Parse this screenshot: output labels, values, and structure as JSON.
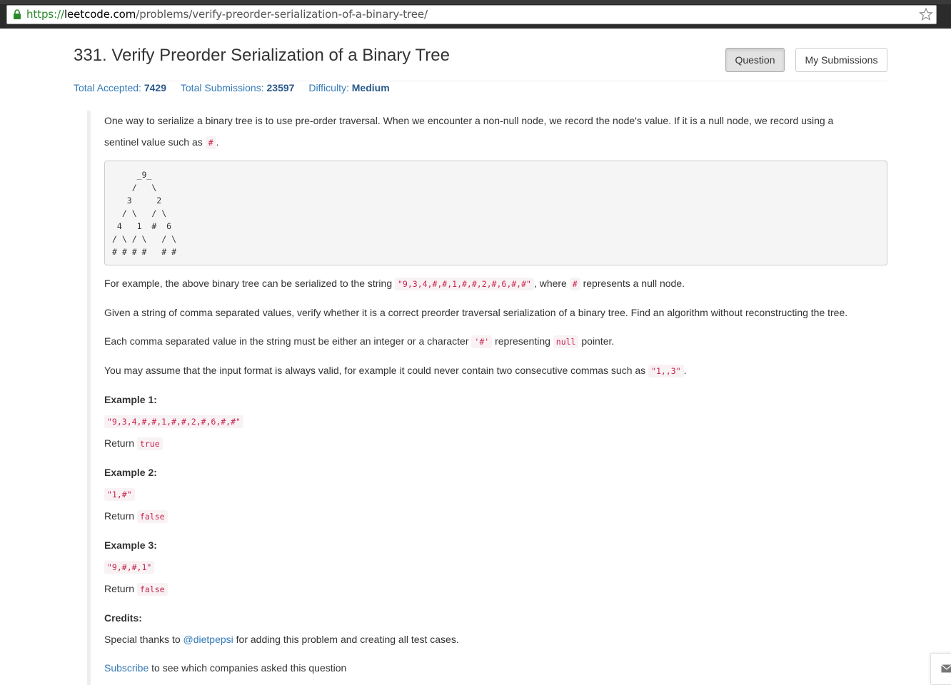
{
  "browser": {
    "url_scheme": "https://",
    "url_host": "leetcode.com",
    "url_path": "/problems/verify-preorder-serialization-of-a-binary-tree/"
  },
  "header": {
    "title": "331. Verify Preorder Serialization of a Binary Tree",
    "question_button": "Question",
    "submissions_button": "My Submissions"
  },
  "stats": {
    "accepted_label": "Total Accepted:",
    "accepted_value": "7429",
    "submissions_label": "Total Submissions:",
    "submissions_value": "23597",
    "difficulty_label": "Difficulty:",
    "difficulty_value": "Medium"
  },
  "body": {
    "intro_line1": "One way to serialize a binary tree is to use pre-order traversal. When we encounter a non-null node, we record the node's value. If it is a null node, we record using a",
    "intro_line2": "sentinel value such as",
    "intro_code": "#",
    "intro_end": ".",
    "tree_ascii": "     _9_\n    /   \\\n   3     2\n  / \\   / \\\n 4   1  #  6\n/ \\ / \\   / \\\n# # # #   # #",
    "example_pre": "For example, the above binary tree can be serialized to the string",
    "example_code": "\"9,3,4,#,#,1,#,#,2,#,6,#,#\"",
    "example_mid": ", where",
    "example_code2": "#",
    "example_post": "represents a null node.",
    "given_text": "Given a string of comma separated values, verify whether it is a correct preorder traversal serialization of a binary tree. Find an algorithm without reconstructing the tree.",
    "each_pre": "Each comma separated value in the string must be either an integer or a character",
    "each_code": "'#'",
    "each_mid": "representing",
    "each_code2": "null",
    "each_post": "pointer.",
    "assume_pre": "You may assume that the input format is always valid, for example it could never contain two consecutive commas such as",
    "assume_code": "\"1,,3\"",
    "assume_post": "."
  },
  "examples": [
    {
      "heading": "Example 1:",
      "input": "\"9,3,4,#,#,1,#,#,2,#,6,#,#\"",
      "return_label": "Return",
      "return_value": "true"
    },
    {
      "heading": "Example 2:",
      "input": "\"1,#\"",
      "return_label": "Return",
      "return_value": "false"
    },
    {
      "heading": "Example 3:",
      "input": "\"9,#,#,1\"",
      "return_label": "Return",
      "return_value": "false"
    }
  ],
  "credits": {
    "heading": "Credits:",
    "pre": "Special thanks to",
    "user_link": "@dietpepsi",
    "post": "for adding this problem and creating all test cases."
  },
  "subscribe": {
    "link": "Subscribe",
    "text": "to see which companies asked this question"
  },
  "icons": {
    "lock": "lock-icon",
    "star": "bookmark-star-icon",
    "mail": "mail-icon"
  }
}
